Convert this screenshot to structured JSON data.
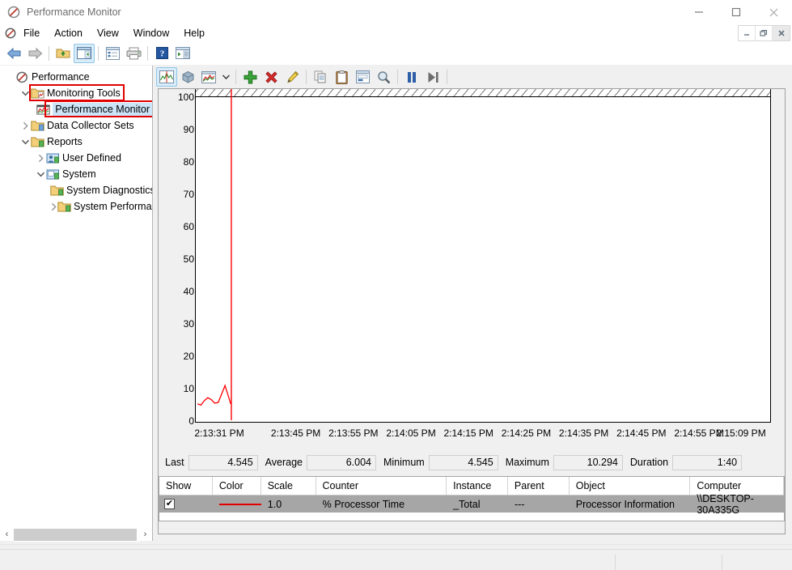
{
  "window": {
    "title": "Performance Monitor",
    "app_icon": "performance-monitor-icon",
    "minimize_label": "–",
    "maximize_label": "□",
    "close_label": "✕"
  },
  "menu": {
    "icon": "mmc-console-icon",
    "items": [
      {
        "label": "File"
      },
      {
        "label": "Action"
      },
      {
        "label": "View"
      },
      {
        "label": "Window"
      },
      {
        "label": "Help"
      }
    ],
    "doc_buttons": [
      {
        "name": "doc-minimize",
        "label": "–"
      },
      {
        "name": "doc-restore",
        "label": "❐"
      },
      {
        "name": "doc-close",
        "label": "✖"
      }
    ]
  },
  "toolbar": {
    "buttons": [
      {
        "name": "back-button",
        "icon": "back-arrow-icon",
        "selected": false
      },
      {
        "name": "forward-button",
        "icon": "forward-arrow-icon",
        "selected": false
      },
      {
        "name": "up-folder-button",
        "icon": "up-folder-icon",
        "selected": false
      },
      {
        "name": "show-hide-console-tree-button",
        "icon": "console-tree-icon",
        "selected": true
      },
      {
        "name": "properties-button",
        "icon": "properties-icon",
        "selected": false
      },
      {
        "name": "print-button",
        "icon": "printer-icon",
        "selected": false
      },
      {
        "name": "help-button",
        "icon": "question-mark-icon",
        "selected": false
      },
      {
        "name": "show-action-pane-button",
        "icon": "action-pane-icon",
        "selected": false
      }
    ]
  },
  "graph_toolbar": {
    "buttons": [
      {
        "name": "view-line-graph-button",
        "icon": "line-graph-icon",
        "selected": true
      },
      {
        "name": "view-histogram-button",
        "icon": "histogram-cube-icon",
        "selected": false
      },
      {
        "name": "view-report-button",
        "icon": "report-view-icon",
        "selected": false
      },
      {
        "name": "change-graph-type-dropdown",
        "icon": "chevron-down-icon",
        "selected": false
      },
      {
        "name": "add-counter-button",
        "icon": "green-plus-icon",
        "selected": false
      },
      {
        "name": "delete-counter-button",
        "icon": "red-x-icon",
        "selected": false
      },
      {
        "name": "highlight-button",
        "icon": "highlighter-pencil-icon",
        "selected": false
      },
      {
        "name": "copy-properties-button",
        "icon": "copy-icon",
        "selected": false
      },
      {
        "name": "paste-counter-list-button",
        "icon": "clipboard-icon",
        "selected": false
      },
      {
        "name": "properties-button",
        "icon": "properties-window-icon",
        "selected": false
      },
      {
        "name": "zoom-button",
        "icon": "magnifier-icon",
        "selected": false
      },
      {
        "name": "freeze-display-button",
        "icon": "pause-icon",
        "selected": false
      },
      {
        "name": "update-data-button",
        "icon": "step-forward-icon",
        "selected": false
      }
    ]
  },
  "tree": {
    "nodes": [
      {
        "label": "Performance",
        "indent": 0,
        "chevron": "none",
        "icon": "performance-root-icon",
        "highlight": "none",
        "selected": false
      },
      {
        "label": "Monitoring Tools",
        "indent": 1,
        "chevron": "down",
        "icon": "folder-monitoring-icon",
        "highlight": "red",
        "selected": false
      },
      {
        "label": "Performance Monitor",
        "indent": 2,
        "chevron": "none",
        "icon": "perfmon-chart-icon",
        "highlight": "red",
        "selected": true
      },
      {
        "label": "Data Collector Sets",
        "indent": 1,
        "chevron": "right",
        "icon": "folder-collector-icon",
        "highlight": "none",
        "selected": false
      },
      {
        "label": "Reports",
        "indent": 1,
        "chevron": "down",
        "icon": "folder-reports-icon",
        "highlight": "none",
        "selected": false
      },
      {
        "label": "User Defined",
        "indent": 2,
        "chevron": "right",
        "icon": "user-defined-icon",
        "highlight": "none",
        "selected": false
      },
      {
        "label": "System",
        "indent": 2,
        "chevron": "down",
        "icon": "system-reports-icon",
        "highlight": "none",
        "selected": false
      },
      {
        "label": "System Diagnostics",
        "indent": 3,
        "chevron": "none",
        "icon": "folder-diagnostics-icon",
        "highlight": "none",
        "selected": false
      },
      {
        "label": "System Performanc",
        "indent": 3,
        "chevron": "right",
        "icon": "folder-performance-icon",
        "highlight": "none",
        "selected": false
      }
    ],
    "scroll_left_arrow": "‹",
    "scroll_right_arrow": "›"
  },
  "chart_data": {
    "type": "line",
    "title": "",
    "xlabel": "",
    "ylabel": "",
    "ylim": [
      0,
      100
    ],
    "yticks": [
      0,
      10,
      20,
      30,
      40,
      50,
      60,
      70,
      80,
      90,
      100
    ],
    "grid": false,
    "legend_position": "bottom-table",
    "xtick_labels": [
      "2:13:31 PM",
      "2:13:45 PM",
      "2:13:55 PM",
      "2:14:05 PM",
      "2:14:15 PM",
      "2:14:25 PM",
      "2:14:35 PM",
      "2:14:45 PM",
      "2:14:55 PM",
      "2:15:09 PM"
    ],
    "xtick_positions_pct": [
      3.5,
      17.5,
      27.5,
      37.5,
      47.5,
      57.5,
      67.5,
      77.5,
      87.5,
      99.5
    ],
    "cursor_line_x_pct": 6.2,
    "cursor_line_color": "#ff0000",
    "series": [
      {
        "name": "% Processor Time",
        "color": "#ff0000",
        "x_pct": [
          0.3,
          0.9,
          1.5,
          2.1,
          2.7,
          3.3,
          3.9,
          4.5,
          5.1,
          5.5,
          5.8,
          6.1
        ],
        "values": [
          4.6,
          4.2,
          5.6,
          6.5,
          5.9,
          4.8,
          5.0,
          7.6,
          10.294,
          8.0,
          6.3,
          4.545
        ]
      }
    ]
  },
  "stats": {
    "fields": [
      {
        "name": "last",
        "label": "Last",
        "value": "4.545",
        "width": 86
      },
      {
        "name": "average",
        "label": "Average",
        "value": "6.004",
        "width": 86
      },
      {
        "name": "minimum",
        "label": "Minimum",
        "value": "4.545",
        "width": 86
      },
      {
        "name": "maximum",
        "label": "Maximum",
        "value": "10.294",
        "width": 86
      },
      {
        "name": "duration",
        "label": "Duration",
        "value": "1:40",
        "width": 86
      }
    ]
  },
  "legend": {
    "columns": [
      {
        "key": "show",
        "label": "Show",
        "width": 66
      },
      {
        "key": "color",
        "label": "Color",
        "width": 60
      },
      {
        "key": "scale",
        "label": "Scale",
        "width": 68
      },
      {
        "key": "counter",
        "label": "Counter",
        "width": 162
      },
      {
        "key": "instance",
        "label": "Instance",
        "width": 76
      },
      {
        "key": "parent",
        "label": "Parent",
        "width": 76
      },
      {
        "key": "object",
        "label": "Object",
        "width": 150
      },
      {
        "key": "computer",
        "label": "Computer",
        "width": 116
      }
    ],
    "rows": [
      {
        "show": true,
        "show_check": "✔",
        "color": "#e00000",
        "scale": "1.0",
        "counter": "% Processor Time",
        "instance": "_Total",
        "parent": "---",
        "object": "Processor Information",
        "computer": "\\\\DESKTOP-30A335G"
      }
    ]
  },
  "statusbar": {
    "panes": [
      "",
      "",
      ""
    ]
  },
  "colors": {
    "accent_red": "#e00000",
    "highlight_red": "#e00000",
    "selection_blue": "#cce4f7",
    "legend_row_gray": "#a6a6a6",
    "window_bg": "#f0f0f0"
  }
}
